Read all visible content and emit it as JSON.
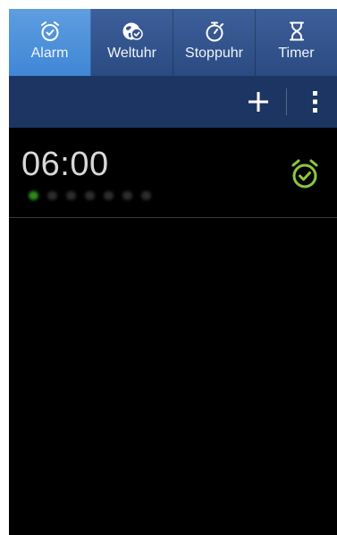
{
  "tabs": [
    {
      "label": "Alarm",
      "icon": "alarm-clock-icon",
      "active": true
    },
    {
      "label": "Weltuhr",
      "icon": "world-clock-icon",
      "active": false
    },
    {
      "label": "Stoppuhr",
      "icon": "stopwatch-icon",
      "active": false
    },
    {
      "label": "Timer",
      "icon": "hourglass-icon",
      "active": false
    }
  ],
  "actionbar": {
    "add_icon": "plus-icon",
    "menu_icon": "more-vertical-icon"
  },
  "alarms": [
    {
      "time": "06:00",
      "days_active": [
        true,
        false,
        false,
        false,
        false,
        false,
        false
      ],
      "icon": "alarm-check-icon",
      "enabled": true
    }
  ],
  "colors": {
    "tab_active": "#4a8fdc",
    "tab_bar": "#34558f",
    "action_bar": "#1d3563",
    "background": "#000000",
    "alarm_on": "#8dc63f"
  }
}
